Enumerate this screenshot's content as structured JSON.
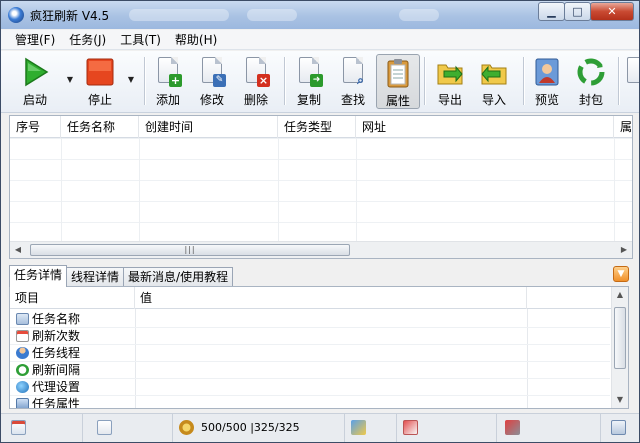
{
  "window": {
    "title": "疯狂刷新 V4.5"
  },
  "menu": [
    "管理(F)",
    "任务(J)",
    "工具(T)",
    "帮助(H)"
  ],
  "toolbar": {
    "start": "启动",
    "stop": "停止",
    "add": "添加",
    "edit": "修改",
    "delete": "删除",
    "copy": "复制",
    "find": "查找",
    "properties": "属性",
    "export": "导出",
    "import": "导入",
    "preview": "预览",
    "seal": "封包"
  },
  "task_table": {
    "columns": [
      "序号",
      "任务名称",
      "创建时间",
      "任务类型",
      "网址",
      "属"
    ]
  },
  "tabs": [
    "任务详情",
    "线程详情",
    "最新消息/使用教程"
  ],
  "detail_table": {
    "columns": [
      "项目",
      "值"
    ],
    "rows": [
      "任务名称",
      "刷新次数",
      "任务线程",
      "刷新间隔",
      "代理设置",
      "任务属性"
    ]
  },
  "status": {
    "counts": "500/500 |325/325"
  },
  "icons": {
    "app": "globe-icon",
    "start": "play-icon",
    "stop": "stop-icon",
    "add": "add-document-icon",
    "edit": "edit-document-icon",
    "delete": "delete-document-icon",
    "copy": "copy-document-icon",
    "find": "search-document-icon",
    "properties": "clipboard-icon",
    "export": "export-folder-icon",
    "import": "import-folder-icon",
    "preview": "user-preview-icon",
    "seal": "recycle-icon"
  },
  "colors": {
    "accent": "#3a7bd5",
    "start_green": "#2fae2f",
    "stop_red": "#e23a1c"
  }
}
